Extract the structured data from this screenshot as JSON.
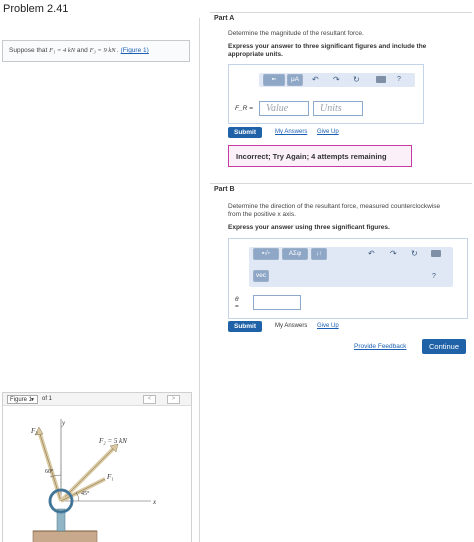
{
  "header": {
    "title": "Problem 2.41"
  },
  "problem": {
    "statement_prefix": "Suppose that",
    "f1": "F₁ = 4  kN",
    "and": "and",
    "f3": "F₃ = 9  kN .",
    "figure_link": "(Figure 1)"
  },
  "figure_panel": {
    "selected_figure": "Figure 1",
    "of_label": "of 1",
    "prev": "<",
    "next": ">",
    "labels": {
      "y": "y",
      "x": "x",
      "f3": "F₃",
      "f2": "F₂ = 5 kN",
      "f1": "F₁",
      "angle60": "60°",
      "angle45": "45°"
    }
  },
  "part_a": {
    "title": "Part A",
    "question": "Determine the magnitude of the resultant force.",
    "instruction_line1": "Express your answer to three significant figures and include the",
    "instruction_line2": "appropriate units.",
    "toolbar": {
      "mu_button": "μA",
      "help": "?"
    },
    "field_label": "F_R =",
    "value_placeholder": "Value",
    "units_placeholder": "Units",
    "submit": "Submit",
    "my_answers": "My Answers",
    "give_up": "Give Up",
    "feedback": "Incorrect; Try Again; 4 attempts remaining"
  },
  "part_b": {
    "title": "Part B",
    "question_line1": "Determine the direction of the resultant force, measured counterclockwise",
    "question_line2": "from the positive x axis.",
    "instruction": "Express your answer using three significant figures.",
    "toolbar": {
      "greek_button": "ΑΣφ",
      "arrows_button": "↓↑",
      "vec_button": "vec",
      "help": "?"
    },
    "field_label_top": "θ",
    "field_label_bottom": "=",
    "submit": "Submit",
    "my_answers": "My Answers",
    "give_up": "Give Up"
  },
  "footer": {
    "provide_feedback": "Provide Feedback",
    "continue": "Continue"
  },
  "colors": {
    "primary": "#1f62a8",
    "link": "#1a5fb4",
    "error_border": "#c43ba4",
    "toolbar_bg": "#dfe8f4"
  }
}
